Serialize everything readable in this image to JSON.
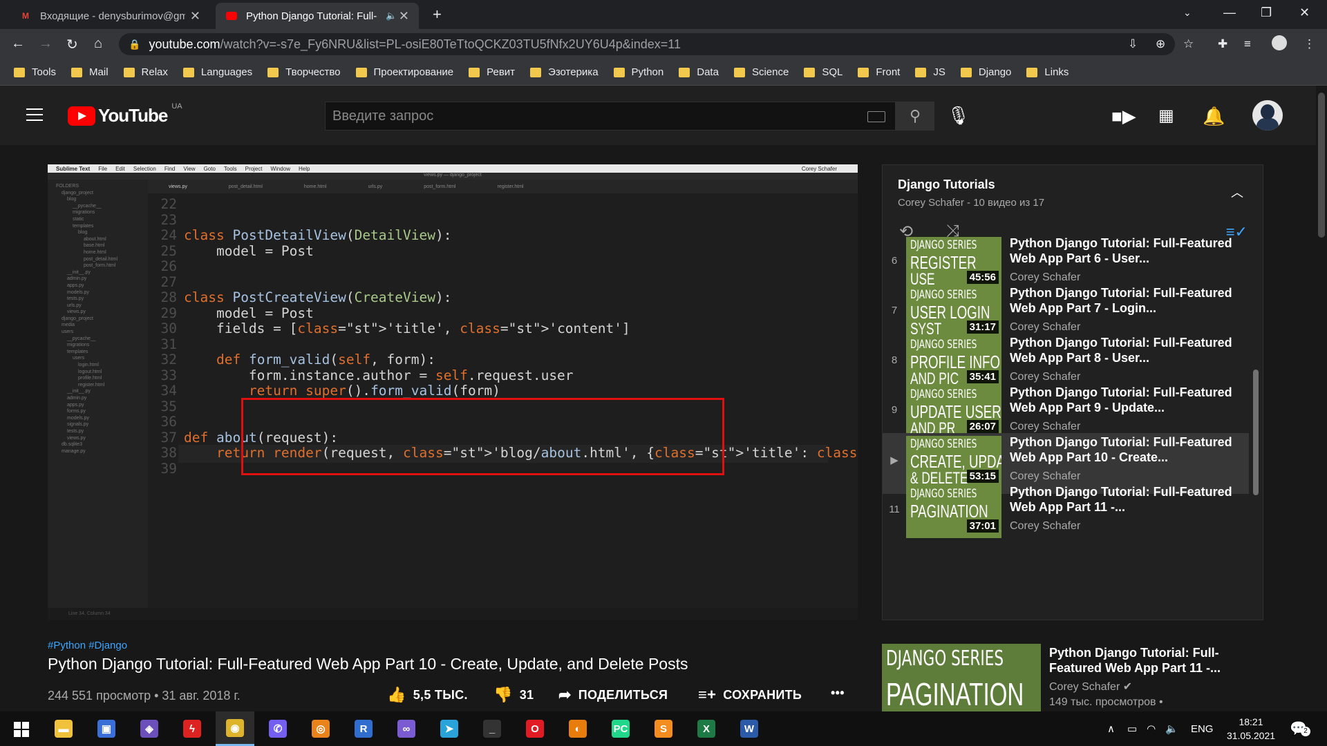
{
  "browser": {
    "tabs": [
      {
        "title": "Входящие - denysburimov@gm",
        "favicon": "gmail-icon"
      },
      {
        "title": "Python Django Tutorial: Full-",
        "favicon": "youtube-icon",
        "audio": true
      }
    ],
    "url_host": "youtube.com",
    "url_rest": "/watch?v=-s7e_Fy6NRU&list=PL-osiE80TeTtoQCKZ03TU5fNfx2UY6U4p&index=11",
    "bookmarks": [
      "Tools",
      "Mail",
      "Relax",
      "Languages",
      "Творчество",
      "Проектирование",
      "Ревит",
      "Эзотерика",
      "Python",
      "Data",
      "Science",
      "SQL",
      "Front",
      "JS",
      "Django",
      "Links"
    ]
  },
  "youtube": {
    "logo_text": "YouTube",
    "region": "UA",
    "search_placeholder": "Введите запрос"
  },
  "editor": {
    "app_menu": [
      "Sublime Text",
      "File",
      "Edit",
      "Selection",
      "Find",
      "View",
      "Goto",
      "Tools",
      "Project",
      "Window",
      "Help"
    ],
    "window_title": "views.py — django_project",
    "user": "Corey Schafer",
    "tabs": [
      "views.py",
      "post_detail.html",
      "home.html",
      "urls.py",
      "post_form.html",
      "register.html"
    ],
    "sidebar": [
      "FOLDERS",
      "django_project",
      "blog",
      "__pycache__",
      "migrations",
      "static",
      "templates",
      "blog",
      "about.html",
      "base.html",
      "home.html",
      "post_detail.html",
      "post_form.html",
      "__init__.py",
      "admin.py",
      "apps.py",
      "models.py",
      "tests.py",
      "urls.py",
      "views.py",
      "django_project",
      "media",
      "users",
      "__pycache__",
      "migrations",
      "templates",
      "users",
      "login.html",
      "logout.html",
      "profile.html",
      "register.html",
      "__init__.py",
      "admin.py",
      "apps.py",
      "forms.py",
      "models.py",
      "signals.py",
      "tests.py",
      "views.py",
      "db.sqlite3",
      "manage.py"
    ],
    "status": "Line 34, Column 34",
    "lines": [
      {
        "n": "22",
        "code": ""
      },
      {
        "n": "23",
        "code": ""
      },
      {
        "n": "24",
        "code": "class PostDetailView(DetailView):"
      },
      {
        "n": "25",
        "code": "    model = Post"
      },
      {
        "n": "26",
        "code": ""
      },
      {
        "n": "27",
        "code": ""
      },
      {
        "n": "28",
        "code": "class PostCreateView(CreateView):"
      },
      {
        "n": "29",
        "code": "    model = Post"
      },
      {
        "n": "30",
        "code": "    fields = ['title', 'content']"
      },
      {
        "n": "31",
        "code": ""
      },
      {
        "n": "32",
        "code": "    def form_valid(self, form):"
      },
      {
        "n": "33",
        "code": "        form.instance.author = self.request.user"
      },
      {
        "n": "34",
        "code": "        return super().form_valid(form)"
      },
      {
        "n": "35",
        "code": ""
      },
      {
        "n": "36",
        "code": ""
      },
      {
        "n": "37",
        "code": "def about(request):"
      },
      {
        "n": "38",
        "code": "    return render(request, 'blog/about.html', {'title': 'About'})"
      },
      {
        "n": "39",
        "code": ""
      }
    ]
  },
  "video": {
    "hashtags": "#Python #Django",
    "title": "Python Django Tutorial: Full-Featured Web App Part 10 - Create, Update, and Delete Posts",
    "views_date": "244 551 просмотр • 31 авг. 2018 г.",
    "likes": "5,5 ТЫС.",
    "dislikes": "31",
    "share": "ПОДЕЛИТЬСЯ",
    "save": "СОХРАНИТЬ",
    "more": "•••"
  },
  "playlist": {
    "title": "Django Tutorials",
    "subtitle": "Corey Schafer - 10 видео из 17",
    "items": [
      {
        "idx": "6",
        "t1": "DJANGO SERIES",
        "t2": "REGISTER",
        "t3": "USE",
        "dur": "45:56",
        "title": "Python Django Tutorial: Full-Featured Web App Part 6 - User...",
        "channel": "Corey Schafer",
        "progress": 1.0
      },
      {
        "idx": "7",
        "t1": "DJANGO SERIES",
        "t2": "USER LOGIN",
        "t3": "SYST",
        "dur": "31:17",
        "title": "Python Django Tutorial: Full-Featured Web App Part 7 - Login...",
        "channel": "Corey Schafer",
        "progress": 1.0
      },
      {
        "idx": "8",
        "t1": "DJANGO SERIES",
        "t2": "PROFILE INFO",
        "t3": "AND PIC",
        "dur": "35:41",
        "title": "Python Django Tutorial: Full-Featured Web App Part 8 - User...",
        "channel": "Corey Schafer",
        "progress": 1.0
      },
      {
        "idx": "9",
        "t1": "DJANGO SERIES",
        "t2": "UPDATE USER",
        "t3": "AND PR",
        "dur": "26:07",
        "title": "Python Django Tutorial: Full-Featured Web App Part 9 - Update...",
        "channel": "Corey Schafer",
        "progress": 1.0
      },
      {
        "idx": "▶",
        "t1": "DJANGO SERIES",
        "t2": "CREATE, UPDATE,",
        "t3": "& DELETE",
        "dur": "53:15",
        "title": "Python Django Tutorial: Full-Featured Web App Part 10 - Create...",
        "channel": "Corey Schafer",
        "progress": 0.4,
        "current": true
      },
      {
        "idx": "11",
        "t1": "DJANGO SERIES",
        "t2": "PAGINATION",
        "t3": "",
        "dur": "37:01",
        "title": "Python Django Tutorial: Full-Featured Web App Part 11 -...",
        "channel": "Corey Schafer",
        "progress": 0
      }
    ]
  },
  "recommended": {
    "t1": "DJANGO SERIES",
    "t2": "PAGINATION",
    "title": "Python Django Tutorial: Full-Featured Web App Part 11 -...",
    "channel": "Corey Schafer",
    "views": "149 тыс. просмотров •"
  },
  "taskbar": {
    "apps": [
      {
        "name": "file-explorer-icon",
        "color": "#f0c23b",
        "glyph": "▬"
      },
      {
        "name": "floppy-save-icon",
        "color": "#3a6fd8",
        "glyph": "▣"
      },
      {
        "name": "app-purple-icon",
        "color": "#6b4fbb",
        "glyph": "◈"
      },
      {
        "name": "app-red-bolt-icon",
        "color": "#d22",
        "glyph": "ϟ"
      },
      {
        "name": "chrome-icon",
        "color": "#dfb42d",
        "glyph": "◉",
        "running": true
      },
      {
        "name": "viber-icon",
        "color": "#7360f2",
        "glyph": "✆"
      },
      {
        "name": "app-eye-icon",
        "color": "#e9841d",
        "glyph": "◎"
      },
      {
        "name": "app-r-icon",
        "color": "#2f6ecf",
        "glyph": "R"
      },
      {
        "name": "visual-studio-icon",
        "color": "#7a5bd1",
        "glyph": "∞"
      },
      {
        "name": "telegram-icon",
        "color": "#2aa3db",
        "glyph": "➤"
      },
      {
        "name": "terminal-icon",
        "color": "#333",
        "glyph": "_"
      },
      {
        "name": "opera-icon",
        "color": "#e01b24",
        "glyph": "O"
      },
      {
        "name": "blender-icon",
        "color": "#e87d0d",
        "glyph": "◐"
      },
      {
        "name": "pycharm-icon",
        "color": "#21d789",
        "glyph": "PC"
      },
      {
        "name": "sublime-icon",
        "color": "#f58c1f",
        "glyph": "S"
      },
      {
        "name": "excel-icon",
        "color": "#1d7a44",
        "glyph": "X"
      },
      {
        "name": "word-icon",
        "color": "#2b5aa8",
        "glyph": "W"
      }
    ],
    "lang": "ENG",
    "time": "18:21",
    "date": "31.05.2021",
    "notifications": "2"
  }
}
